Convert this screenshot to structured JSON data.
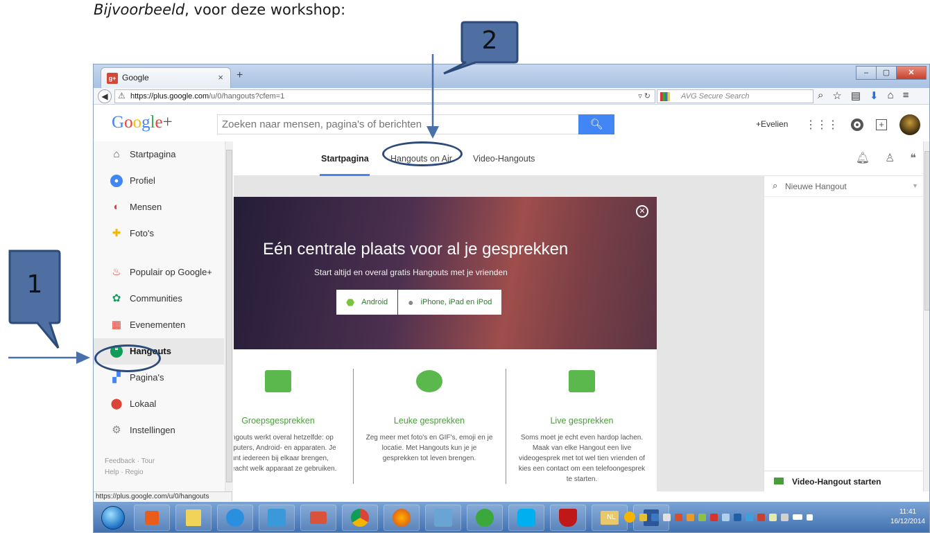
{
  "doc": {
    "heading_italic": "Bijvoorbeeld",
    "heading_rest": ", voor deze workshop:",
    "callout1": "1",
    "callout2": "2"
  },
  "browser": {
    "tab_title": "Google",
    "tab_close": "×",
    "new_tab": "+",
    "url_host": "https://plus.google.com",
    "url_path": "/u/0/hangouts?cfem=1",
    "search_provider": "AVG Secure Search",
    "status_url": "https://plus.google.com/u/0/hangouts"
  },
  "gplus": {
    "logo": "Google+",
    "search_placeholder": "Zoeken naar mensen, pagina's of berichten",
    "user": "+Evelien"
  },
  "leftnav": {
    "items": [
      {
        "label": "Startpagina",
        "icon": "home-icon"
      },
      {
        "label": "Profiel",
        "icon": "profile-icon"
      },
      {
        "label": "Mensen",
        "icon": "people-icon"
      },
      {
        "label": "Foto's",
        "icon": "photos-icon"
      },
      {
        "label": "Populair op Google+",
        "icon": "flame-icon"
      },
      {
        "label": "Communities",
        "icon": "communities-icon"
      },
      {
        "label": "Evenementen",
        "icon": "calendar-icon"
      },
      {
        "label": "Hangouts",
        "icon": "hangouts-icon"
      },
      {
        "label": "Pagina's",
        "icon": "pages-icon"
      },
      {
        "label": "Lokaal",
        "icon": "location-pin-icon"
      },
      {
        "label": "Instellingen",
        "icon": "gear-icon"
      }
    ],
    "footer1": "Feedback · Tour",
    "footer2": "Help · Regio"
  },
  "subtabs": {
    "tabs": [
      "Startpagina",
      "Hangouts on Air",
      "Video-Hangouts"
    ],
    "active": "Startpagina"
  },
  "hero": {
    "title": "Eén centrale plaats voor al je gesprekken",
    "subtitle": "Start altijd en overal gratis Hangouts met je vrienden",
    "android_btn": "Android",
    "ios_btn": "iPhone, iPad en iPod"
  },
  "features": [
    {
      "title": "Groepsgesprekken",
      "text": "Hangouts werkt overal hetzelfde: op computers, Android- en apparaten. Je kunt iedereen bij elkaar brengen, ongeacht welk apparaat ze gebruiken.",
      "icon": "group-chat-icon"
    },
    {
      "title": "Leuke gesprekken",
      "text": "Zeg meer met foto's en GIF's, emoji en je locatie. Met Hangouts kun je je gesprekken tot leven brengen.",
      "icon": "smiley-chat-icon"
    },
    {
      "title": "Live gesprekken",
      "text": "Soms moet je echt even hardop lachen. Maak van elke Hangout een live videogesprek met tot wel tien vrienden of kies een contact om een telefoongesprek te starten.",
      "icon": "video-camera-icon"
    }
  ],
  "rpanel": {
    "search_placeholder": "Nieuwe Hangout",
    "video_start": "Video-Hangout starten"
  },
  "taskbar": {
    "lang": "NL",
    "time": "11:41",
    "date": "16/12/2014"
  },
  "colors": {
    "gplus_blue": "#4285f4",
    "hangouts_green": "#5bb84d",
    "callout_blue": "#4f6fa3",
    "callout_border": "#2c4b7a"
  }
}
